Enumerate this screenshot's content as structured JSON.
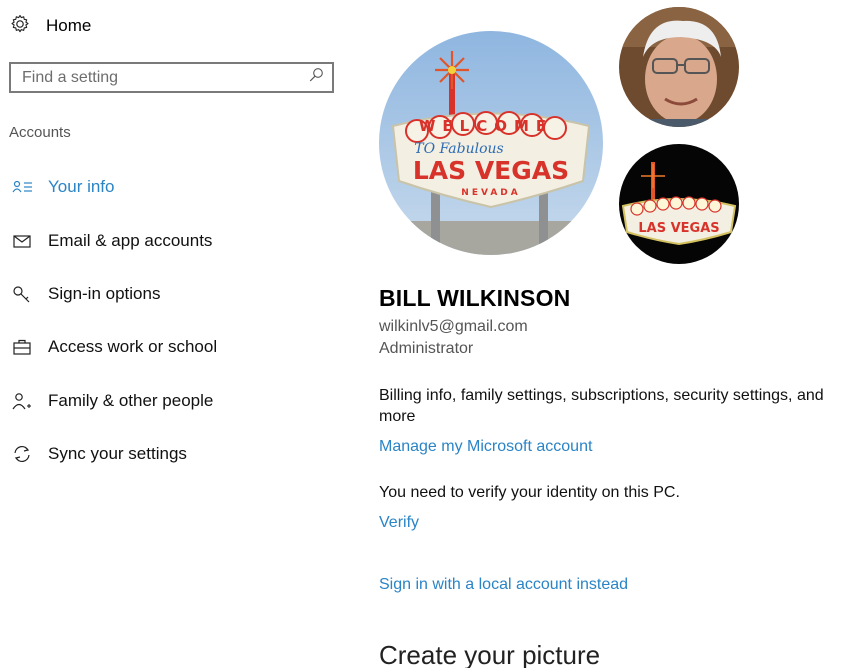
{
  "sidebar": {
    "home": {
      "label": "Home",
      "icon": "gear-icon"
    },
    "search": {
      "placeholder": "Find a setting",
      "icon": "search-icon"
    },
    "section_title": "Accounts",
    "items": [
      {
        "label": "Your info",
        "icon": "person-list-icon",
        "active": true
      },
      {
        "label": "Email & app accounts",
        "icon": "mail-icon",
        "active": false
      },
      {
        "label": "Sign-in options",
        "icon": "key-icon",
        "active": false
      },
      {
        "label": "Access work or school",
        "icon": "briefcase-icon",
        "active": false
      },
      {
        "label": "Family & other people",
        "icon": "add-person-icon",
        "active": false
      },
      {
        "label": "Sync your settings",
        "icon": "sync-icon",
        "active": false
      }
    ]
  },
  "main": {
    "user_name": "BILL WILKINSON",
    "email": "wilkinlv5@gmail.com",
    "role": "Administrator",
    "billing_text": "Billing info, family settings, subscriptions, security settings, and more",
    "manage_link": "Manage my Microsoft account",
    "verify_message": "You need to verify your identity on this PC.",
    "verify_link": "Verify",
    "local_account_link": "Sign in with a local account instead",
    "create_picture_heading": "Create your picture",
    "sign_text": {
      "welcome": "WELCOME",
      "to_fabulous": "TO Fabulous",
      "las_vegas": "LAS VEGAS",
      "nevada": "NEVADA"
    }
  },
  "colors": {
    "accent": "#2a84c6",
    "sign_red": "#d8332b",
    "sign_yellow": "#f2d13a",
    "sky_blue": "#9fc3e6"
  }
}
